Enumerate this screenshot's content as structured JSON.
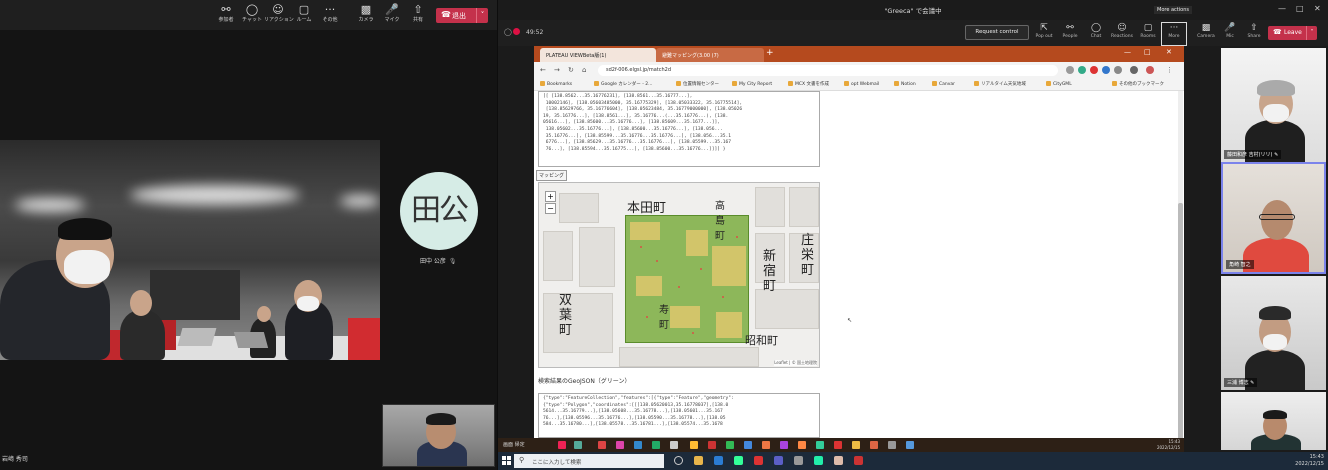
{
  "left_window": {
    "toolbar": [
      {
        "label": "参加者",
        "icon": "people-icon"
      },
      {
        "label": "チャット",
        "icon": "chat-icon"
      },
      {
        "label": "リアクション",
        "icon": "reaction-icon"
      },
      {
        "label": "ルーム",
        "icon": "rooms-icon"
      },
      {
        "label": "その他",
        "icon": "more-icon"
      },
      {
        "label": "カメラ",
        "icon": "camera-icon"
      },
      {
        "label": "マイク",
        "icon": "mic-icon"
      },
      {
        "label": "共有",
        "icon": "share-icon"
      }
    ],
    "leave_label": "退出",
    "room_participant_name": "岩﨑 秀司",
    "avatar_initials": "田公",
    "avatar_name": "田中 公彦",
    "mic_glyph": "🎙"
  },
  "right_window": {
    "title": "\"Greeca\" で会議中",
    "meeting_time": "49:52",
    "request_control_label": "Request control",
    "toolbar": [
      {
        "label": "Pop out"
      },
      {
        "label": "People"
      },
      {
        "label": "Chat"
      },
      {
        "label": "Reactions"
      },
      {
        "label": "Rooms"
      },
      {
        "label": "More"
      },
      {
        "label": "Camera"
      },
      {
        "label": "Mic"
      },
      {
        "label": "Share"
      }
    ],
    "more_tooltip": "More actions",
    "leave_label": "Leave"
  },
  "browser": {
    "tabs": [
      "PLATEAU VIEWBeta版(1)",
      "避難マッピング(3.00 (7)"
    ],
    "url": "sd2f-006.elgsl.jp/match2d",
    "bookmarks": [
      "Bookmarks",
      "Google カレンダー - 2...",
      "位置情報センター",
      "My City Report",
      "MCX 文書を作成",
      "opt Webmail",
      "Notion",
      "Canvar",
      "リアルタイム天気地域",
      "CityGML",
      "その他のブックマーク"
    ],
    "code_block_1": [
      "[[ [138.8562...35.16776231], [138.8561...35.16777...], ",
      " 10002146], [138.05603485000, 35.16775329], [138.05033322, 35.16775514],",
      " [138.85629766, 35.16776604], [138.05623484, 35.16779000000], [138.05026",
      "19, 35.16776...], [138.8561...], 35.16776...(...35.16776...), [138.",
      "05616...], [138.85600...35.16776...], [138.85609...35.1677...]],",
      " 138.05602...35.16776...], [138.85600...35.16776...], [138.056...",
      " 35.16776...], [138.85599...35.16776...35.16776...], [138.056...35.1",
      " 6776...], [138.85629...35.16776...35.16776...], [138.05599...35.167",
      " 76...], [138.85594...35.16775...], [138.85600...35.16776...]]]] }"
    ],
    "map_tab_label": "マッピング",
    "map_place_names": [
      "本田町",
      "新宿町",
      "庄栄町",
      "双葉町",
      "高島町",
      "寿町",
      "昭和町"
    ],
    "map_attribution": "Leaflet | © 国土地理院",
    "geojson_label": "検索結果のGeoJSON（グリーン）",
    "code_block_2": [
      "{\"type\":\"FeatureCollection\",\"features\":[{\"type\":\"Feature\",\"geometry\":",
      "{\"type\":\"Polygon\",\"coordinates\":[[[138.05620013,35.16778037],[138.0",
      "5614...35.16779...],[138.05608...35.16778...],[138.05601...35.167",
      "76...],[138.05596...35.16776...],[138.05590...35.16778...],[138.05",
      "584...35.16780...],[138.05578...35.16781...],[138.05574...35.1678"
    ]
  },
  "inner_taskbar": {
    "label": "画面 帰定",
    "clock_time": "15:43",
    "clock_date": "2022/12/15"
  },
  "taskbar": {
    "search_placeholder": "ここに入力して検索",
    "clock_time": "15:43",
    "clock_date": "2022/12/15"
  },
  "participants": [
    {
      "name": "藤田和彦 吉村(リリ) ✎"
    },
    {
      "name": "角崎 智之"
    },
    {
      "name": "三浦 博志 ✎"
    },
    {
      "name": ""
    }
  ],
  "colors": {
    "leave_red": "#c4314b",
    "browser_tab_orange": "#b54a1e",
    "map_green": "#8db75a",
    "active_speaker": "#7b83eb"
  }
}
